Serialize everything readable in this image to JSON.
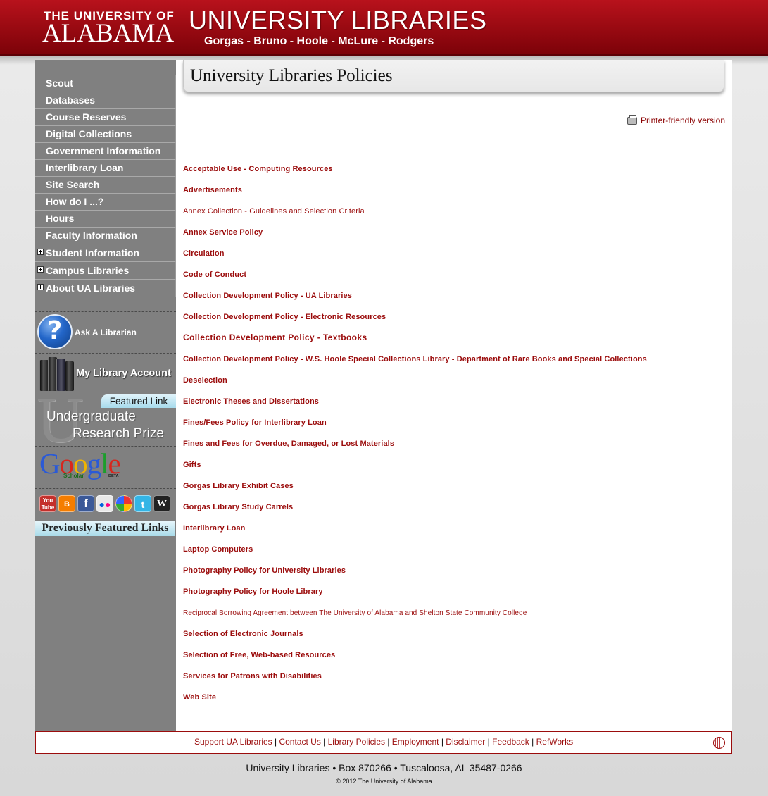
{
  "header": {
    "ua_top": "THE UNIVERSITY OF",
    "ua_name": "ALABAMA",
    "title": "UNIVERSITY LIBRARIES",
    "branches": "Gorgas - Bruno - Hoole - McLure - Rodgers"
  },
  "sidebar": {
    "nav": [
      {
        "label": "Scout"
      },
      {
        "label": "Databases"
      },
      {
        "label": "Course Reserves"
      },
      {
        "label": "Digital Collections"
      },
      {
        "label": "Government Information"
      },
      {
        "label": "Interlibrary Loan"
      },
      {
        "label": "Site Search"
      },
      {
        "label": "How do I ...?"
      },
      {
        "label": "Hours"
      },
      {
        "label": "Faculty Information"
      },
      {
        "label": "Student Information",
        "expandable": true
      },
      {
        "label": "Campus Libraries",
        "expandable": true
      },
      {
        "label": "About UA Libraries",
        "expandable": true
      }
    ],
    "ask_librarian": "Ask A Librarian",
    "ask_icon_glyph": "?",
    "my_account": "My Library Account",
    "featured_tag": "Featured Link",
    "featured_line1": "Undergraduate",
    "featured_line2": "Research Prize",
    "featured_watermark": "U",
    "google_logo": "Google",
    "google_sub": "Scholar",
    "google_beta": "BETA",
    "social_icons": [
      "youtube-icon",
      "blogger-icon",
      "facebook-icon",
      "flickr-icon",
      "picasa-icon",
      "twitter-icon",
      "wordpress-icon"
    ],
    "previously_featured": "Previously Featured Links"
  },
  "main": {
    "title": "University Libraries Policies",
    "printer_friendly": "Printer-friendly version",
    "policies": [
      "Acceptable Use - Computing Resources",
      "Advertisements",
      "Annex Collection - Guidelines and Selection Criteria",
      "Annex Service Policy",
      "Circulation",
      "Code of Conduct",
      "Collection Development Policy - UA Libraries",
      "Collection Development Policy - Electronic Resources",
      "Collection Development Policy - Textbooks",
      "Collection Development Policy - W.S. Hoole Special Collections Library - Department of Rare Books and Special Collections",
      "Deselection",
      "Electronic Theses and Dissertations",
      "Fines/Fees Policy for Interlibrary Loan",
      "Fines and Fees for Overdue, Damaged, or Lost Materials",
      "Gifts",
      "Gorgas Library Exhibit Cases",
      "Gorgas Library Study Carrels",
      "Interlibrary Loan",
      "Laptop Computers",
      "Photography Policy for University Libraries",
      "Photography Policy for Hoole Library",
      "Reciprocal Borrowing Agreement between The University of Alabama and Shelton State Community College",
      "Selection of Electronic Journals",
      "Selection of Free, Web-based Resources",
      "Services for Patrons with Disabilities",
      "Web Site"
    ]
  },
  "footer": {
    "links": [
      "Support UA Libraries",
      "Contact Us",
      "Library Policies",
      "Employment",
      "Disclaimer",
      "Feedback",
      "RefWorks"
    ],
    "address": "University Libraries • Box 870266 • Tuscaloosa, AL 35487-0266",
    "copyright": "© 2012 The University of Alabama"
  },
  "colors": {
    "brand_crimson": "#9b0c0c",
    "sidebar_gray": "#808080",
    "featured_blue": "#a9dbe9"
  }
}
